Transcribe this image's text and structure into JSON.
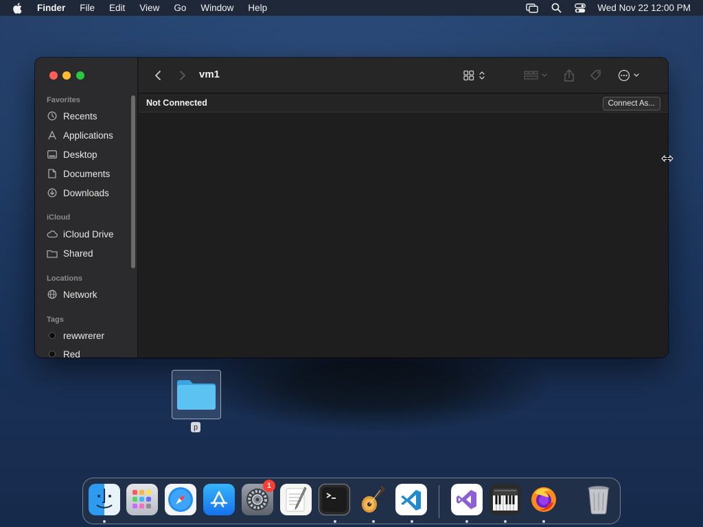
{
  "menubar": {
    "app_name": "Finder",
    "items": [
      "File",
      "Edit",
      "View",
      "Go",
      "Window",
      "Help"
    ],
    "clock": "Wed Nov 22  12:00 PM"
  },
  "window": {
    "title": "vm1",
    "sidebar": {
      "sections": {
        "favorites": "Favorites",
        "icloud": "iCloud",
        "locations": "Locations",
        "tags": "Tags"
      },
      "favorites": [
        "Recents",
        "Applications",
        "Desktop",
        "Documents",
        "Downloads"
      ],
      "icloud": [
        "iCloud Drive",
        "Shared"
      ],
      "locations": [
        "Network"
      ],
      "tags": [
        "rewwrerer",
        "Red"
      ]
    },
    "status": "Not Connected",
    "connect_button": "Connect As..."
  },
  "desktop": {
    "folder_label": "p"
  },
  "dock": {
    "apps": [
      "Finder",
      "Launchpad",
      "Safari",
      "App Store",
      "System Preferences",
      "TextEdit",
      "Terminal",
      "GarageBand",
      "Visual Studio Code",
      "Visual Studio",
      "Piano",
      "Firefox",
      "Trash"
    ],
    "badge_count": "1"
  },
  "colors": {
    "close": "#ff5f57",
    "minimize": "#febc2e",
    "maximize": "#28c840",
    "badge": "#ff3b30",
    "folder": "#4fb6ec"
  }
}
